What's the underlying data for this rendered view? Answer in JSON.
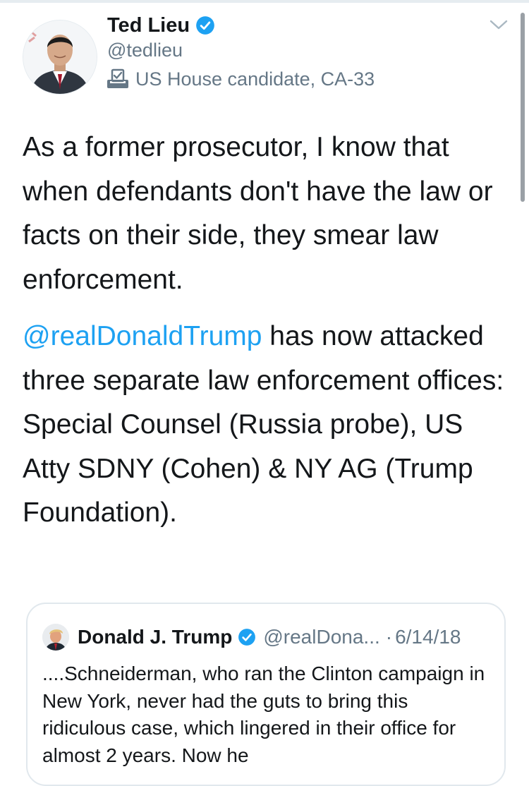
{
  "tweet": {
    "author_name": "Ted Lieu",
    "handle": "@tedlieu",
    "label": "US House candidate, CA-33",
    "paragraph1": "As a former prosecutor, I know that when defendants don't have the law or facts on their side, they smear law enforcement.",
    "mention": "@realDonaldTrump",
    "paragraph2_rest": " has now attacked three separate law enforcement offices: Special Counsel (Russia probe), US Atty SDNY (Cohen) & NY AG (Trump Foundation)."
  },
  "quoted_tweet": {
    "author_name": "Donald J. Trump",
    "handle": "@realDona...",
    "separator": "·",
    "date": "6/14/18",
    "text": "....Schneiderman, who ran the Clinton campaign in New York, never had the guts to bring this ridiculous case, which lingered in their office for almost 2 years. Now he"
  },
  "colors": {
    "text": "#14171a",
    "secondary": "#657786",
    "link": "#1da1f2",
    "verified": "#1da1f2",
    "border": "#e1e8ed"
  },
  "icons": {
    "verified": "verified-badge-icon",
    "label": "ballot-box-icon",
    "menu": "chevron-down-icon"
  }
}
